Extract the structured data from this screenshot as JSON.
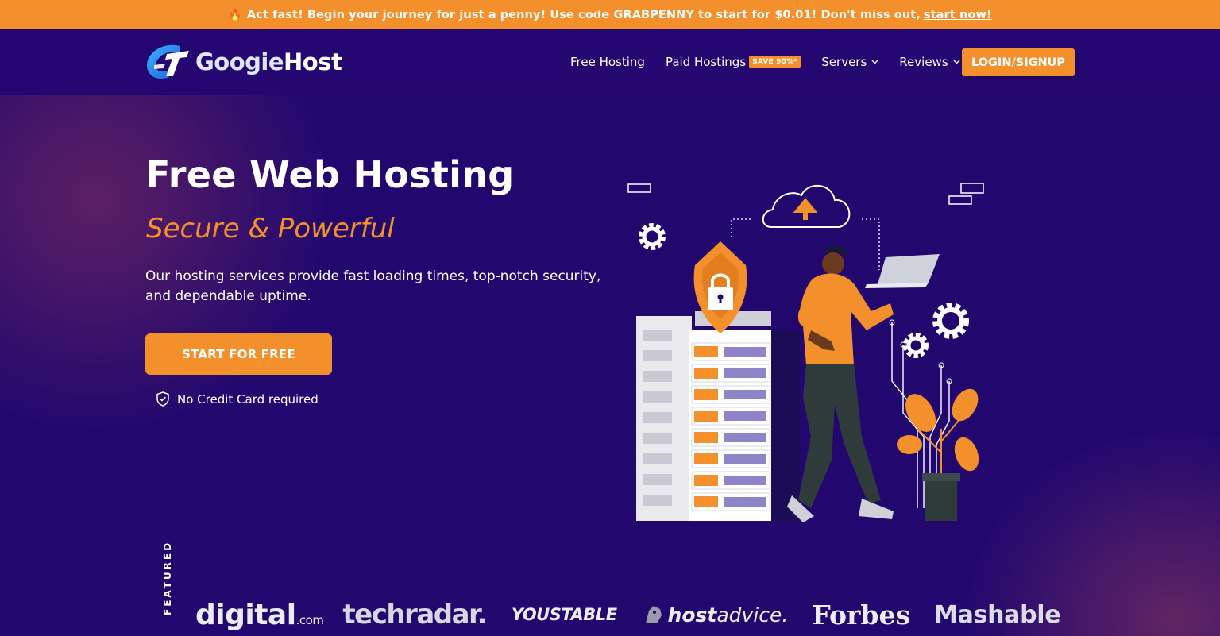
{
  "promo": {
    "icon": "fire-icon",
    "text": "Act fast! Begin your journey for just a penny! Use code GRABPENNY to start for $0.01! Don't miss out,",
    "link": "start now!"
  },
  "header": {
    "logo": {
      "part1": "Googie",
      "part2": "Host"
    },
    "nav": {
      "free_hosting": "Free Hosting",
      "paid_hostings": "Paid Hostings",
      "paid_badge": "SAVE 90%*",
      "servers": "Servers",
      "reviews": "Reviews"
    },
    "login_label": "LOGIN/SIGNUP"
  },
  "hero": {
    "title": "Free Web Hosting",
    "subtitle": "Secure & Powerful",
    "description": "Our hosting services provide fast loading times, top-notch security, and dependable uptime.",
    "cta_label": "START FOR FREE",
    "nocc_label": "No Credit Card required"
  },
  "featured": {
    "label": "FEATURED ON",
    "brands": {
      "digital": "digital",
      "digital_suffix": ".com",
      "techradar": "techradar.",
      "youstable": "YOUSTABLE",
      "hostadvice_bold": "host",
      "hostadvice_rest": "advice.",
      "forbes": "Forbes",
      "mashable": "Mashable"
    }
  },
  "colors": {
    "accent": "#f4902c",
    "background": "#22086e",
    "promo_bg": "#f4902c"
  }
}
